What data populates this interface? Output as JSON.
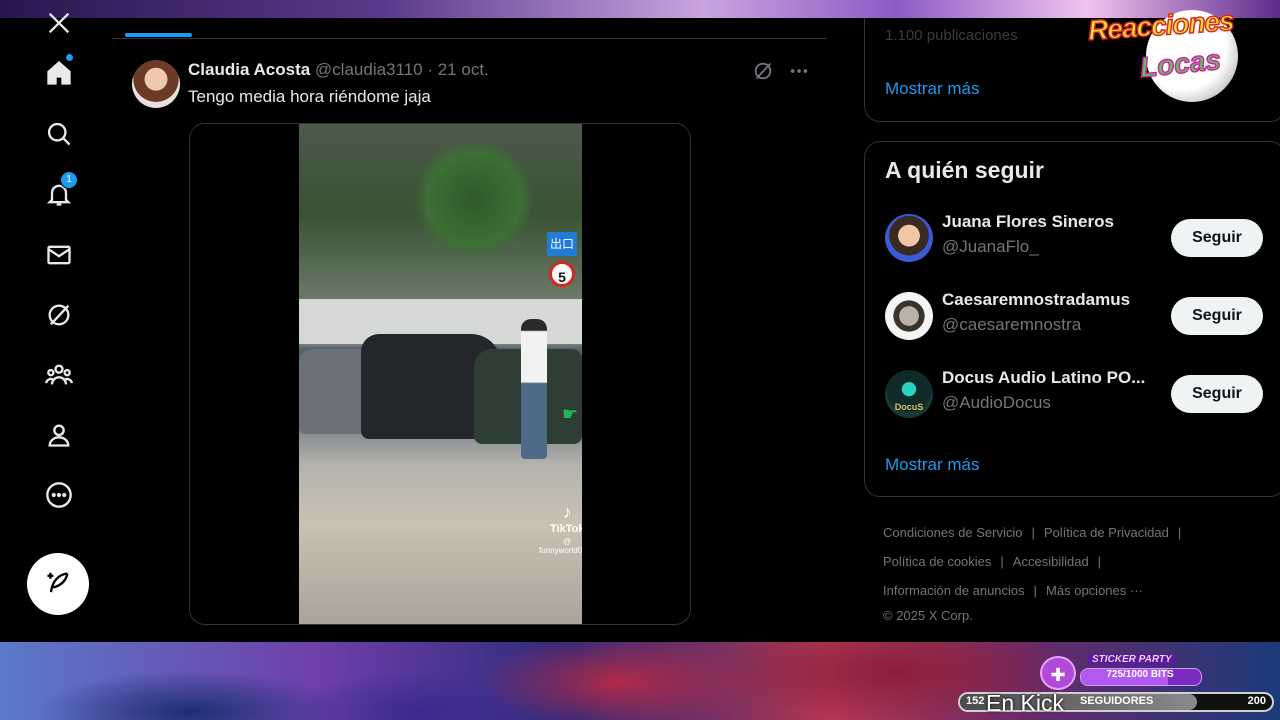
{
  "nav": {
    "notifications_badge": "1",
    "icons": [
      "x-logo-icon",
      "home-icon",
      "search-icon",
      "bell-icon",
      "mail-icon",
      "grok-icon",
      "communities-icon",
      "profile-icon",
      "more-icon"
    ]
  },
  "tweet": {
    "author_name": "Claudia Acosta",
    "author_handle": "@claudia3110",
    "date": "· 21 oct.",
    "text": "Tengo media hora riéndome jaja",
    "video": {
      "sign_text": "出口",
      "speed_limit": "5",
      "watermark": "TikTok",
      "watermark_user": "@ funnyworld0013"
    }
  },
  "sidebar_right": {
    "trends_faded": "1.100 publicaciones",
    "trends_more": "Mostrar más",
    "who_to_follow": {
      "title": "A quién seguir",
      "users": [
        {
          "name": "Juana Flores Sineros",
          "handle": "@JuanaFlo_",
          "button": "Seguir"
        },
        {
          "name": "Caesaremnostradamus",
          "handle": "@caesaremnostra",
          "button": "Seguir"
        },
        {
          "name": "Docus Audio Latino PO...",
          "handle": "@AudioDocus",
          "button": "Seguir",
          "avatar_text": "DocuS"
        }
      ],
      "more": "Mostrar más"
    },
    "footer": {
      "terms": "Condiciones de Servicio",
      "privacy": "Política de Privacidad",
      "cookies": "Política de cookies",
      "accessibility": "Accesibilidad",
      "ads_info": "Información de anuncios",
      "more_options": "Más opciones ···",
      "copyright": "© 2025 X Corp."
    }
  },
  "overlay": {
    "logo_line1": "Reacciones",
    "logo_line2": "Locas",
    "sticker_label": "STICKER PARTY",
    "sticker_progress_text": "725/1000 BITS",
    "sticker_progress": 0.725,
    "followers_current": "152",
    "followers_label": "SEGUIDORES",
    "followers_goal": "200",
    "followers_progress": 0.76,
    "platform_text": "En Kick"
  }
}
